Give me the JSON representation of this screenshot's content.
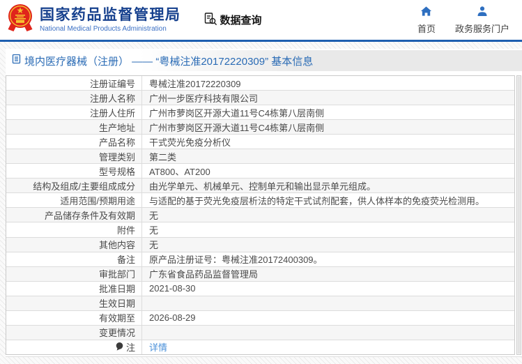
{
  "header": {
    "org_name_cn": "国家药品监督管理局",
    "org_name_en": "National Medical Products Administration",
    "data_query_label": "数据查询",
    "nav": [
      {
        "label": "首页",
        "icon": "home-icon"
      },
      {
        "label": "政务服务门户",
        "icon": "person-icon"
      }
    ],
    "logo_icon": "national-emblem-icon",
    "data_query_icon": "doc-search-icon"
  },
  "page": {
    "title": "境内医疗器械（注册） —— “粤械注准20172220309” 基本信息",
    "title_icon": "document-icon"
  },
  "table": {
    "rows": [
      {
        "label": "注册证编号",
        "value": "粤械注准20172220309"
      },
      {
        "label": "注册人名称",
        "value": "广州一步医疗科技有限公司"
      },
      {
        "label": "注册人住所",
        "value": "广州市萝岗区开源大道11号C4栋第八层南侧"
      },
      {
        "label": "生产地址",
        "value": "广州市萝岗区开源大道11号C4栋第八层南侧"
      },
      {
        "label": "产品名称",
        "value": "干式荧光免疫分析仪"
      },
      {
        "label": "管理类别",
        "value": "第二类"
      },
      {
        "label": "型号规格",
        "value": "AT800、AT200"
      },
      {
        "label": "结构及组成/主要组成成分",
        "value": "由光学单元、机械单元、控制单元和输出显示单元组成。"
      },
      {
        "label": "适用范围/预期用途",
        "value": "与适配的基于荧光免疫层析法的特定干式试剂配套，供人体样本的免疫荧光检测用。"
      },
      {
        "label": "产品储存条件及有效期",
        "value": "无"
      },
      {
        "label": "附件",
        "value": "无"
      },
      {
        "label": "其他内容",
        "value": "无"
      },
      {
        "label": "备注",
        "value": "原产品注册证号：粤械注准20172400309。"
      },
      {
        "label": "审批部门",
        "value": "广东省食品药品监督管理局"
      },
      {
        "label": "批准日期",
        "value": "2021-08-30"
      },
      {
        "label": "生效日期",
        "value": ""
      },
      {
        "label": "有效期至",
        "value": "2026-08-29"
      },
      {
        "label": "变更情况",
        "value": ""
      },
      {
        "label": "注",
        "value": "详情",
        "label_icon": "note-bubble-icon",
        "value_is_link": true
      }
    ]
  },
  "colors": {
    "header_border_blue": "#1e5fb0",
    "brand_blue": "#17418e",
    "brand_sub_blue": "#3a6fc4",
    "nav_icon_blue": "#2e6fc0",
    "page_title_blue": "#2a6bb5",
    "link_blue": "#4a90d9",
    "emblem_red": "#e0251b",
    "emblem_gold": "#f6c430",
    "row_alt_gray": "#f6f6f6",
    "titlebar_gray": "#e9e9e9"
  }
}
